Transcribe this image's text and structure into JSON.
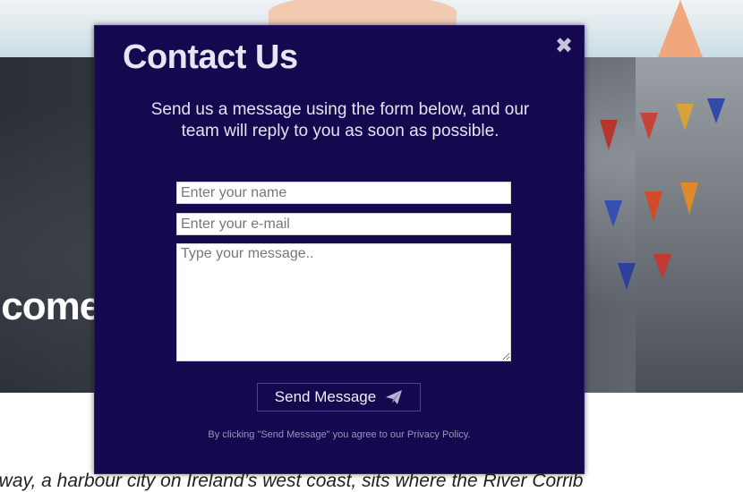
{
  "background": {
    "hero_title": "lcome",
    "body_text": "lway, a harbour city on Ireland’s west coast, sits where the River Corrib"
  },
  "modal": {
    "title": "Contact Us",
    "close_glyph": "✖",
    "intro": "Send us a message using the form below, and our team will reply to you as soon as possible.",
    "fields": {
      "name": {
        "value": "",
        "placeholder": "Enter your name"
      },
      "email": {
        "value": "",
        "placeholder": "Enter your e-mail"
      },
      "message": {
        "value": "",
        "placeholder": "Type your message.."
      }
    },
    "send_label": "Send Message",
    "send_icon": "paper-plane-icon",
    "disclaimer": "By clicking \"Send Message\" you agree to our Privacy Policy.",
    "colors": {
      "modal_bg": "#16084f",
      "title": "#e8e4f4",
      "button_border": "#4c4390",
      "disclaimer": "#9b96b8"
    }
  }
}
